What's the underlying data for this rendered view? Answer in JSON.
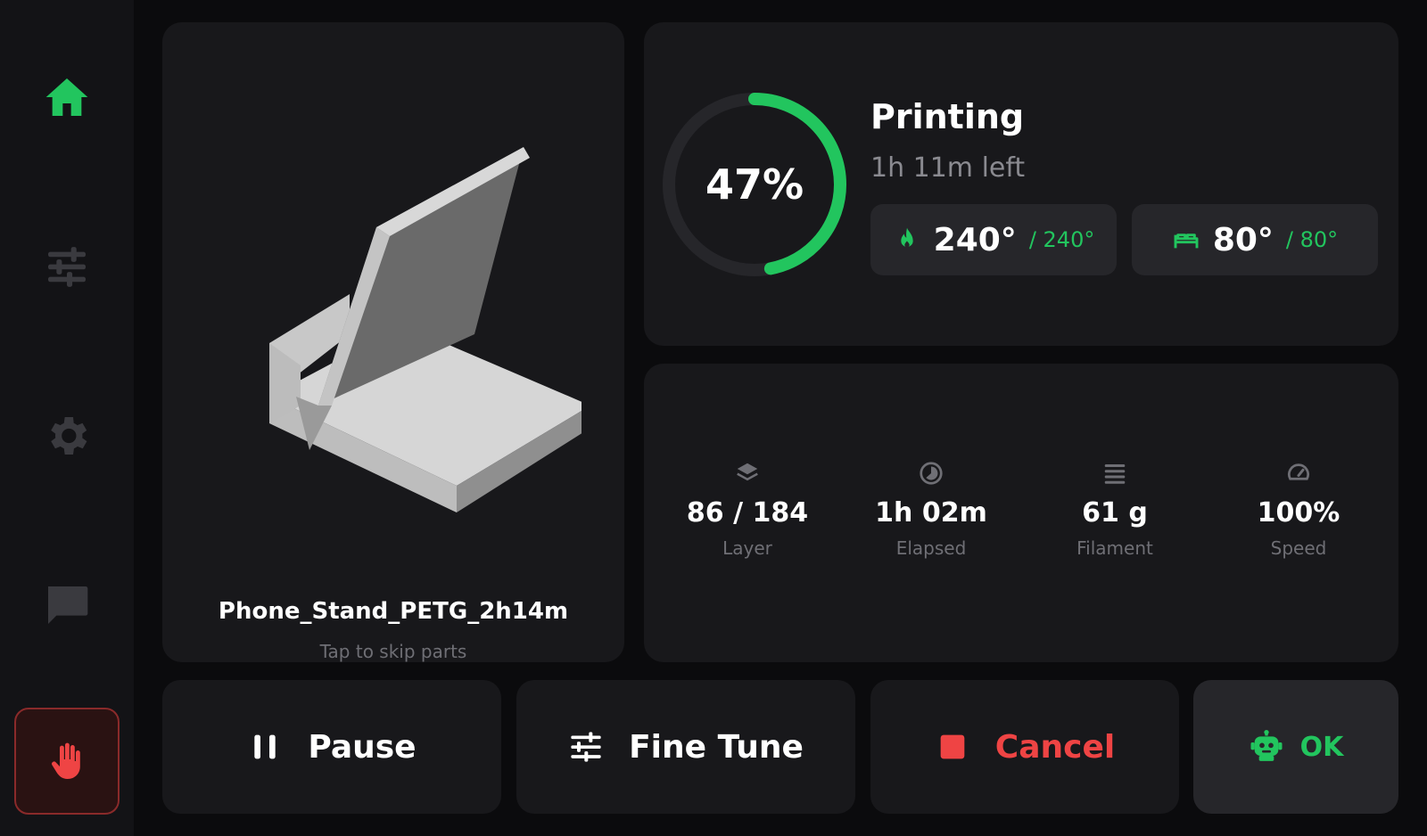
{
  "colors": {
    "accent": "#22c55e",
    "danger": "#ef4444",
    "card": "#18181b",
    "muted": "#6f6f75"
  },
  "sidebar": {
    "items": [
      {
        "icon": "home-icon",
        "active": true
      },
      {
        "icon": "sliders-icon",
        "active": false
      },
      {
        "icon": "gear-icon",
        "active": false
      },
      {
        "icon": "chat-icon",
        "active": false
      }
    ],
    "estop_icon": "hand-stop-icon"
  },
  "model": {
    "filename": "Phone_Stand_PETG_2h14m",
    "hint": "Tap to skip parts"
  },
  "status": {
    "progress_percent": 47,
    "progress_label": "47%",
    "title": "Printing",
    "remaining": "1h 11m left",
    "nozzle": {
      "current": "240°",
      "target": "/ 240°",
      "icon": "flame-icon"
    },
    "bed": {
      "current": "80°",
      "target": "/ 80°",
      "icon": "bed-icon"
    }
  },
  "stats": [
    {
      "icon": "layers-icon",
      "value": "86 / 184",
      "label": "Layer"
    },
    {
      "icon": "clock-icon",
      "value": "1h 02m",
      "label": "Elapsed"
    },
    {
      "icon": "filament-icon",
      "value": "61 g",
      "label": "Filament"
    },
    {
      "icon": "gauge-icon",
      "value": "100%",
      "label": "Speed"
    }
  ],
  "actions": {
    "pause": {
      "label": "Pause",
      "icon": "pause-icon"
    },
    "fine_tune": {
      "label": "Fine Tune",
      "icon": "sliders-icon"
    },
    "cancel": {
      "label": "Cancel",
      "icon": "stop-icon"
    },
    "ok": {
      "label": "OK",
      "icon": "robot-icon"
    }
  }
}
